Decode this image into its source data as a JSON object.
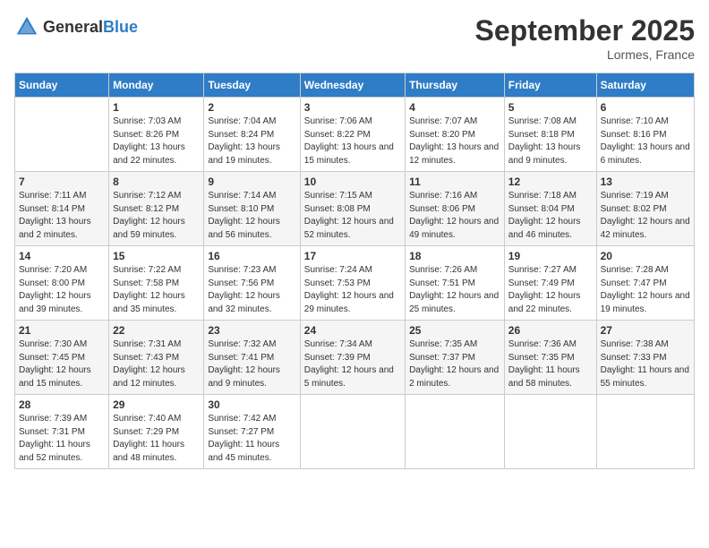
{
  "header": {
    "logo_general": "General",
    "logo_blue": "Blue",
    "month_title": "September 2025",
    "location": "Lormes, France"
  },
  "days_of_week": [
    "Sunday",
    "Monday",
    "Tuesday",
    "Wednesday",
    "Thursday",
    "Friday",
    "Saturday"
  ],
  "weeks": [
    [
      {
        "day": "",
        "sunrise": "",
        "sunset": "",
        "daylight": ""
      },
      {
        "day": "1",
        "sunrise": "Sunrise: 7:03 AM",
        "sunset": "Sunset: 8:26 PM",
        "daylight": "Daylight: 13 hours and 22 minutes."
      },
      {
        "day": "2",
        "sunrise": "Sunrise: 7:04 AM",
        "sunset": "Sunset: 8:24 PM",
        "daylight": "Daylight: 13 hours and 19 minutes."
      },
      {
        "day": "3",
        "sunrise": "Sunrise: 7:06 AM",
        "sunset": "Sunset: 8:22 PM",
        "daylight": "Daylight: 13 hours and 15 minutes."
      },
      {
        "day": "4",
        "sunrise": "Sunrise: 7:07 AM",
        "sunset": "Sunset: 8:20 PM",
        "daylight": "Daylight: 13 hours and 12 minutes."
      },
      {
        "day": "5",
        "sunrise": "Sunrise: 7:08 AM",
        "sunset": "Sunset: 8:18 PM",
        "daylight": "Daylight: 13 hours and 9 minutes."
      },
      {
        "day": "6",
        "sunrise": "Sunrise: 7:10 AM",
        "sunset": "Sunset: 8:16 PM",
        "daylight": "Daylight: 13 hours and 6 minutes."
      }
    ],
    [
      {
        "day": "7",
        "sunrise": "Sunrise: 7:11 AM",
        "sunset": "Sunset: 8:14 PM",
        "daylight": "Daylight: 13 hours and 2 minutes."
      },
      {
        "day": "8",
        "sunrise": "Sunrise: 7:12 AM",
        "sunset": "Sunset: 8:12 PM",
        "daylight": "Daylight: 12 hours and 59 minutes."
      },
      {
        "day": "9",
        "sunrise": "Sunrise: 7:14 AM",
        "sunset": "Sunset: 8:10 PM",
        "daylight": "Daylight: 12 hours and 56 minutes."
      },
      {
        "day": "10",
        "sunrise": "Sunrise: 7:15 AM",
        "sunset": "Sunset: 8:08 PM",
        "daylight": "Daylight: 12 hours and 52 minutes."
      },
      {
        "day": "11",
        "sunrise": "Sunrise: 7:16 AM",
        "sunset": "Sunset: 8:06 PM",
        "daylight": "Daylight: 12 hours and 49 minutes."
      },
      {
        "day": "12",
        "sunrise": "Sunrise: 7:18 AM",
        "sunset": "Sunset: 8:04 PM",
        "daylight": "Daylight: 12 hours and 46 minutes."
      },
      {
        "day": "13",
        "sunrise": "Sunrise: 7:19 AM",
        "sunset": "Sunset: 8:02 PM",
        "daylight": "Daylight: 12 hours and 42 minutes."
      }
    ],
    [
      {
        "day": "14",
        "sunrise": "Sunrise: 7:20 AM",
        "sunset": "Sunset: 8:00 PM",
        "daylight": "Daylight: 12 hours and 39 minutes."
      },
      {
        "day": "15",
        "sunrise": "Sunrise: 7:22 AM",
        "sunset": "Sunset: 7:58 PM",
        "daylight": "Daylight: 12 hours and 35 minutes."
      },
      {
        "day": "16",
        "sunrise": "Sunrise: 7:23 AM",
        "sunset": "Sunset: 7:56 PM",
        "daylight": "Daylight: 12 hours and 32 minutes."
      },
      {
        "day": "17",
        "sunrise": "Sunrise: 7:24 AM",
        "sunset": "Sunset: 7:53 PM",
        "daylight": "Daylight: 12 hours and 29 minutes."
      },
      {
        "day": "18",
        "sunrise": "Sunrise: 7:26 AM",
        "sunset": "Sunset: 7:51 PM",
        "daylight": "Daylight: 12 hours and 25 minutes."
      },
      {
        "day": "19",
        "sunrise": "Sunrise: 7:27 AM",
        "sunset": "Sunset: 7:49 PM",
        "daylight": "Daylight: 12 hours and 22 minutes."
      },
      {
        "day": "20",
        "sunrise": "Sunrise: 7:28 AM",
        "sunset": "Sunset: 7:47 PM",
        "daylight": "Daylight: 12 hours and 19 minutes."
      }
    ],
    [
      {
        "day": "21",
        "sunrise": "Sunrise: 7:30 AM",
        "sunset": "Sunset: 7:45 PM",
        "daylight": "Daylight: 12 hours and 15 minutes."
      },
      {
        "day": "22",
        "sunrise": "Sunrise: 7:31 AM",
        "sunset": "Sunset: 7:43 PM",
        "daylight": "Daylight: 12 hours and 12 minutes."
      },
      {
        "day": "23",
        "sunrise": "Sunrise: 7:32 AM",
        "sunset": "Sunset: 7:41 PM",
        "daylight": "Daylight: 12 hours and 9 minutes."
      },
      {
        "day": "24",
        "sunrise": "Sunrise: 7:34 AM",
        "sunset": "Sunset: 7:39 PM",
        "daylight": "Daylight: 12 hours and 5 minutes."
      },
      {
        "day": "25",
        "sunrise": "Sunrise: 7:35 AM",
        "sunset": "Sunset: 7:37 PM",
        "daylight": "Daylight: 12 hours and 2 minutes."
      },
      {
        "day": "26",
        "sunrise": "Sunrise: 7:36 AM",
        "sunset": "Sunset: 7:35 PM",
        "daylight": "Daylight: 11 hours and 58 minutes."
      },
      {
        "day": "27",
        "sunrise": "Sunrise: 7:38 AM",
        "sunset": "Sunset: 7:33 PM",
        "daylight": "Daylight: 11 hours and 55 minutes."
      }
    ],
    [
      {
        "day": "28",
        "sunrise": "Sunrise: 7:39 AM",
        "sunset": "Sunset: 7:31 PM",
        "daylight": "Daylight: 11 hours and 52 minutes."
      },
      {
        "day": "29",
        "sunrise": "Sunrise: 7:40 AM",
        "sunset": "Sunset: 7:29 PM",
        "daylight": "Daylight: 11 hours and 48 minutes."
      },
      {
        "day": "30",
        "sunrise": "Sunrise: 7:42 AM",
        "sunset": "Sunset: 7:27 PM",
        "daylight": "Daylight: 11 hours and 45 minutes."
      },
      {
        "day": "",
        "sunrise": "",
        "sunset": "",
        "daylight": ""
      },
      {
        "day": "",
        "sunrise": "",
        "sunset": "",
        "daylight": ""
      },
      {
        "day": "",
        "sunrise": "",
        "sunset": "",
        "daylight": ""
      },
      {
        "day": "",
        "sunrise": "",
        "sunset": "",
        "daylight": ""
      }
    ]
  ]
}
